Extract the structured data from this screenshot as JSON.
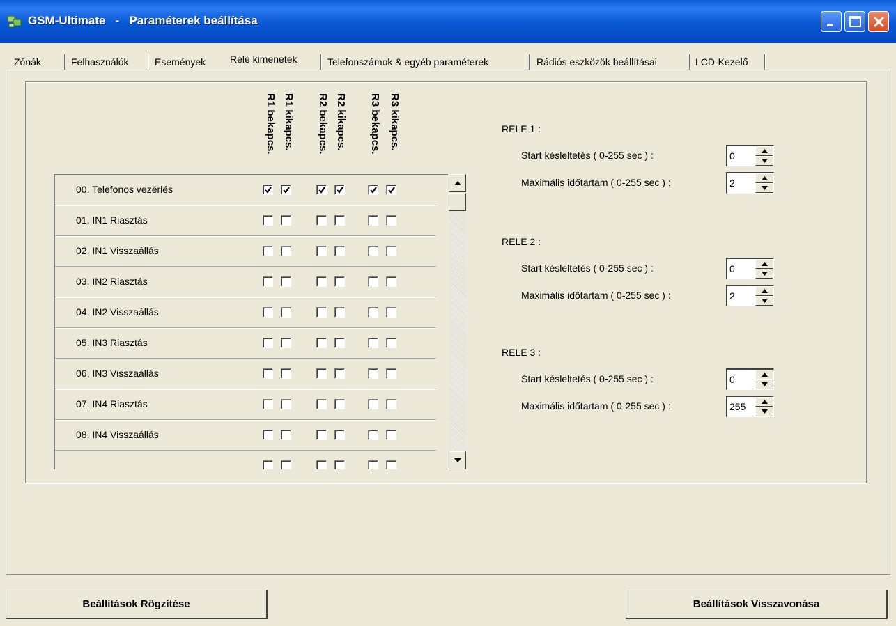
{
  "window": {
    "title": "GSM-Ultimate   -   Paraméterek beállítása"
  },
  "tabs": [
    {
      "label": "Zónák"
    },
    {
      "label": "Felhasználók"
    },
    {
      "label": "Események"
    },
    {
      "label": "Relé kimenetek",
      "active": true
    },
    {
      "label": "Telefonszámok & egyéb paraméterek"
    },
    {
      "label": "Rádiós eszközök beállításai"
    },
    {
      "label": "LCD-Kezelő"
    }
  ],
  "columns": [
    {
      "label": "R1 bekapcs."
    },
    {
      "label": "R1 kikapcs."
    },
    {
      "label": "R2 bekapcs."
    },
    {
      "label": "R2 kikapcs."
    },
    {
      "label": "R3 bekapcs."
    },
    {
      "label": "R3 kikapcs."
    }
  ],
  "events": [
    {
      "label": "00. Telefonos vezérlés",
      "checks": [
        true,
        true,
        true,
        true,
        true,
        true
      ]
    },
    {
      "label": "01. IN1 Riasztás",
      "checks": [
        false,
        false,
        false,
        false,
        false,
        false
      ]
    },
    {
      "label": "02. IN1 Visszaállás",
      "checks": [
        false,
        false,
        false,
        false,
        false,
        false
      ]
    },
    {
      "label": "03. IN2 Riasztás",
      "checks": [
        false,
        false,
        false,
        false,
        false,
        false
      ]
    },
    {
      "label": "04. IN2 Visszaállás",
      "checks": [
        false,
        false,
        false,
        false,
        false,
        false
      ]
    },
    {
      "label": "05. IN3 Riasztás",
      "checks": [
        false,
        false,
        false,
        false,
        false,
        false
      ]
    },
    {
      "label": "06. IN3 Visszaállás",
      "checks": [
        false,
        false,
        false,
        false,
        false,
        false
      ]
    },
    {
      "label": "07. IN4 Riasztás",
      "checks": [
        false,
        false,
        false,
        false,
        false,
        false
      ]
    },
    {
      "label": "08. IN4 Visszaállás",
      "checks": [
        false,
        false,
        false,
        false,
        false,
        false
      ]
    },
    {
      "label": "",
      "checks": [
        false,
        false,
        false,
        false,
        false,
        false
      ]
    }
  ],
  "relays": [
    {
      "title": "RELE 1 :",
      "start_label": "Start késleltetés ( 0-255 sec ) :",
      "start_value": "0",
      "max_label": "Maximális időtartam ( 0-255 sec ) :",
      "max_value": "2"
    },
    {
      "title": "RELE 2 :",
      "start_label": "Start késleltetés ( 0-255 sec ) :",
      "start_value": "0",
      "max_label": "Maximális időtartam ( 0-255 sec ) :",
      "max_value": "2"
    },
    {
      "title": "RELE 3 :",
      "start_label": "Start késleltetés ( 0-255 sec ) :",
      "start_value": "0",
      "max_label": "Maximális időtartam ( 0-255 sec ) :",
      "max_value": "255"
    }
  ],
  "buttons": {
    "save": "Beállítások Rögzítése",
    "revert": "Beállítások Visszavonása"
  }
}
